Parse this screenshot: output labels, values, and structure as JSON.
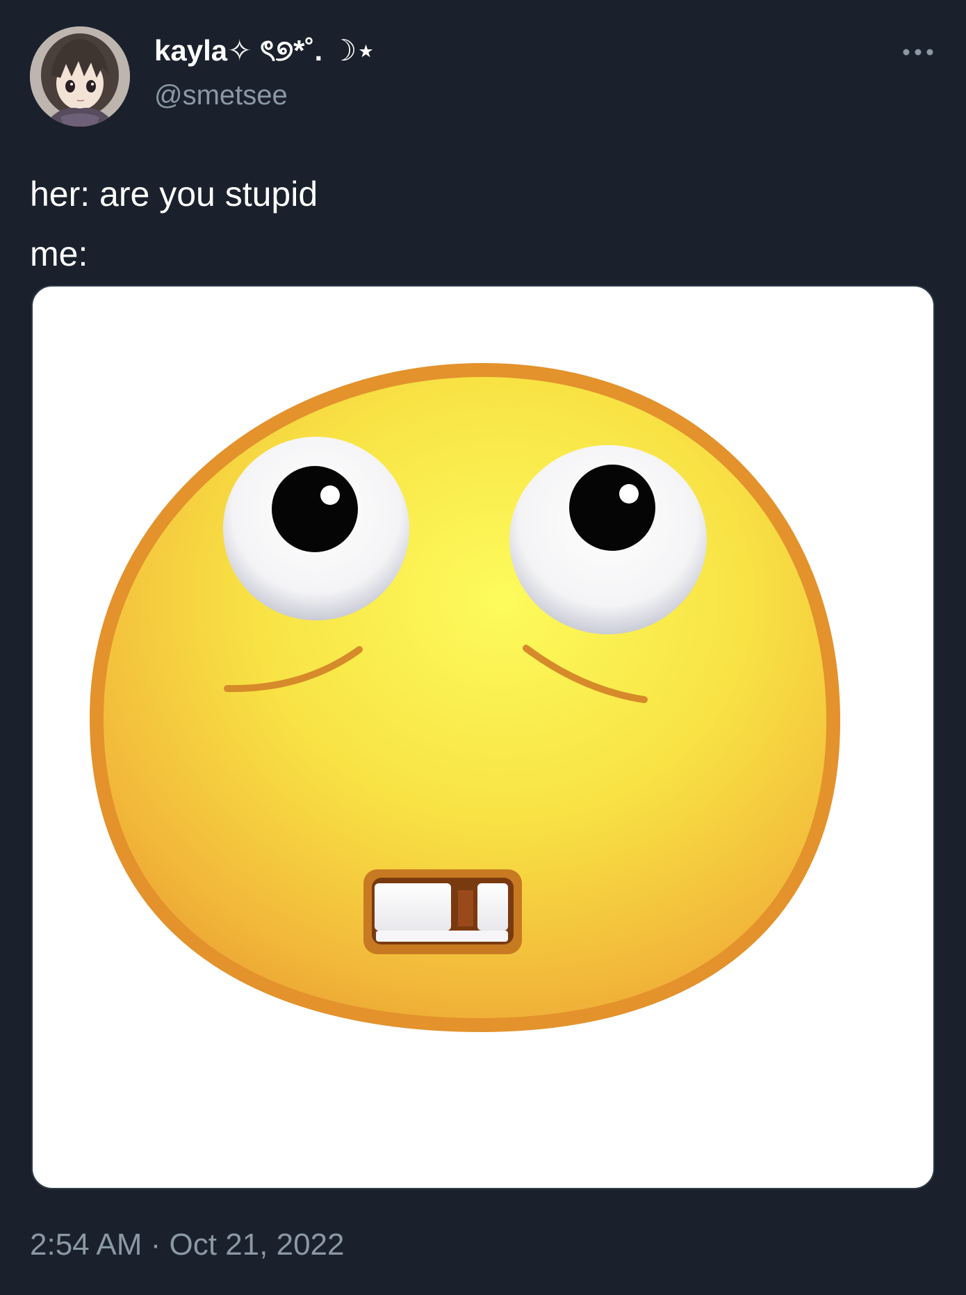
{
  "author": {
    "display_name": "kayla✧ ৎ୭*˚. ☽⋆",
    "handle": "@smetsee",
    "avatar_icon": "anime-avatar"
  },
  "tweet": {
    "text": "her: are you stupid\nme:",
    "timestamp": "2:54 AM · Oct 21, 2022",
    "media_icon": "goofy-emoji-face"
  },
  "actions": {
    "more_icon": "more-horizontal-icon"
  },
  "colors": {
    "background": "#1a212c",
    "primary_text": "#ffffff",
    "secondary_text": "#8b98a5"
  }
}
